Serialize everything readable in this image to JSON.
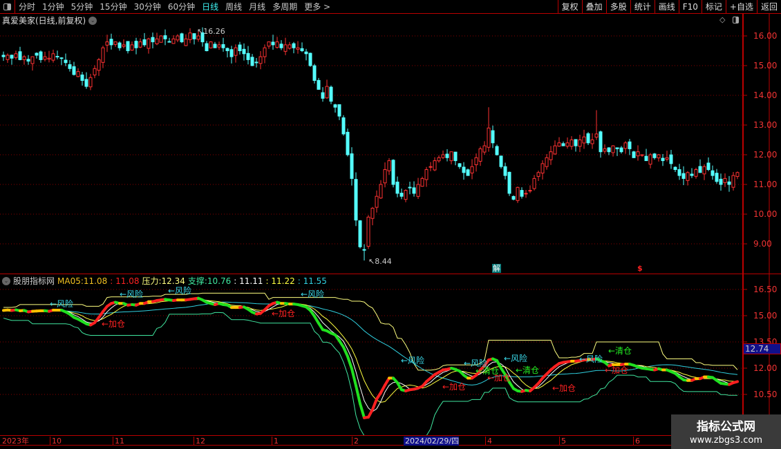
{
  "toolbar": {
    "periods": [
      "分时",
      "1分钟",
      "5分钟",
      "15分钟",
      "30分钟",
      "60分钟",
      "日线",
      "周线",
      "月线",
      "多周期",
      "更多 >"
    ],
    "active_index": 6,
    "buttons": [
      "复权",
      "叠加",
      "多股",
      "统计",
      "画线",
      "F10",
      "标记",
      "+自选",
      "返回"
    ]
  },
  "title": "真爱美家(日线,前复权)",
  "main_chart": {
    "y_ticks": [
      "16.00",
      "15.00",
      "14.00",
      "13.00",
      "12.00",
      "11.00",
      "10.00",
      "9.00"
    ],
    "high_label": "16.26",
    "low_label": "8.44",
    "badge_jie": "解",
    "badge_s": "$"
  },
  "indicator": {
    "name": "股朋指标网",
    "ma_label": "MA05:",
    "ma_v1": "11.08",
    "ma_v2": ": 11.08",
    "pressure_label": "压力:",
    "pressure_val": "12.34",
    "support_label": "支撑:",
    "support_val": "10.76",
    "v3": ": 11.11",
    "v4": ": 11.22",
    "v5": ": 11.55",
    "y_ticks": [
      "16.50",
      "15.00",
      "13.50",
      "12.00",
      "10.50"
    ],
    "current_price": "12.74",
    "annotations": {
      "risk": "←风险",
      "add": "←加仓",
      "clear": "←清仓"
    }
  },
  "time_axis": [
    "2023年",
    "10",
    "11",
    "12",
    "1",
    "2",
    "2024/02/29/四",
    "4",
    "5",
    "6"
  ],
  "watermark": {
    "title": "指标公式网",
    "url": "www.zbgs3.com"
  },
  "colors": {
    "up": "#ff3232",
    "down": "#54ffff",
    "grid": "#8b0000",
    "pressure": "#ffff80",
    "support": "#40e8a0",
    "ma_long": "#30d0e0"
  },
  "chart_data": {
    "type": "candlestick",
    "closes": [
      15.3,
      15.35,
      15.25,
      15.4,
      15.2,
      15.3,
      15.15,
      15.3,
      15.35,
      15.2,
      15.3,
      15.25,
      15.4,
      15.3,
      15.25,
      15.1,
      14.9,
      14.7,
      14.8,
      14.5,
      14.3,
      14.6,
      14.9,
      15.2,
      15.6,
      15.8,
      15.7,
      15.8,
      15.6,
      15.7,
      15.5,
      15.7,
      15.6,
      15.8,
      15.7,
      15.9,
      15.8,
      15.9,
      16.0,
      15.9,
      15.8,
      15.9,
      16.0,
      15.8,
      15.9,
      16.1,
      15.9,
      16.0,
      15.8,
      15.5,
      15.8,
      15.6,
      15.7,
      15.6,
      15.5,
      15.3,
      15.6,
      15.5,
      15.4,
      15.2,
      15.0,
      15.1,
      15.3,
      15.6,
      15.8,
      15.7,
      15.8,
      15.6,
      15.7,
      15.7,
      15.6,
      15.6,
      15.5,
      15.4,
      15.0,
      14.5,
      14.2,
      13.9,
      14.3,
      13.8,
      13.6,
      13.3,
      12.7,
      12.0,
      11.2,
      9.8,
      8.9,
      8.8,
      9.9,
      10.2,
      10.6,
      11.0,
      11.5,
      11.8,
      11.0,
      10.7,
      10.6,
      10.8,
      10.9,
      10.7,
      11.0,
      11.2,
      11.5,
      11.6,
      11.8,
      11.9,
      12.0,
      11.9,
      12.1,
      11.8,
      11.6,
      11.4,
      11.3,
      11.6,
      11.9,
      12.2,
      12.3,
      12.9,
      12.4,
      12.0,
      11.6,
      11.3,
      10.7,
      10.5,
      10.9,
      10.6,
      10.7,
      10.8,
      11.2,
      11.4,
      11.7,
      11.9,
      12.1,
      12.3,
      12.4,
      12.3,
      12.4,
      12.5,
      12.3,
      12.5,
      12.6,
      12.4,
      12.5,
      12.7,
      12.1,
      12.2,
      12.1,
      12.3,
      12.2,
      12.1,
      12.4,
      12.2,
      11.9,
      12.1,
      12.0,
      11.8,
      12.0,
      11.9,
      12.0,
      11.8,
      11.9,
      11.7,
      11.5,
      11.3,
      11.2,
      11.4,
      11.3,
      11.5,
      11.4,
      11.6,
      11.5,
      11.3,
      11.1,
      11.0,
      11.2,
      11.0,
      11.3,
      11.4
    ],
    "main_ylim": [
      8.2,
      16.4
    ],
    "indicator_ylim": [
      9.0,
      17.0
    ]
  }
}
